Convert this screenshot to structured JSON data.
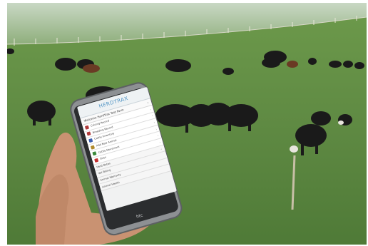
{
  "scene": {
    "description_colors": {
      "sky": "#d9e4d5",
      "grass": "#5f8a43",
      "grass_dark": "#4d7636",
      "cattle": "#1c1c1c",
      "phone_body": "#8a8d90"
    }
  },
  "phone_app": {
    "title": "HERDTRAX",
    "welcome": "Welcome HerdTrax Test Farm",
    "items": [
      {
        "label": "Calving Record",
        "color": "#b03a3a"
      },
      {
        "label": "Breeding Record",
        "color": "#b03a3a"
      },
      {
        "label": "Cattle Inventory",
        "color": "#3b5fb0"
      },
      {
        "label": "Add New Animal",
        "color": "#b08a2a"
      },
      {
        "label": "Cattle Movement",
        "color": "#3b8a3b"
      },
      {
        "label": "Sires",
        "color": "#c43030"
      },
      {
        "label": "Herd Notes",
        "color": ""
      },
      {
        "label": "Vet Billing",
        "color": ""
      },
      {
        "label": "Animal Warranty",
        "color": ""
      },
      {
        "label": "Animal Health",
        "color": ""
      }
    ]
  }
}
